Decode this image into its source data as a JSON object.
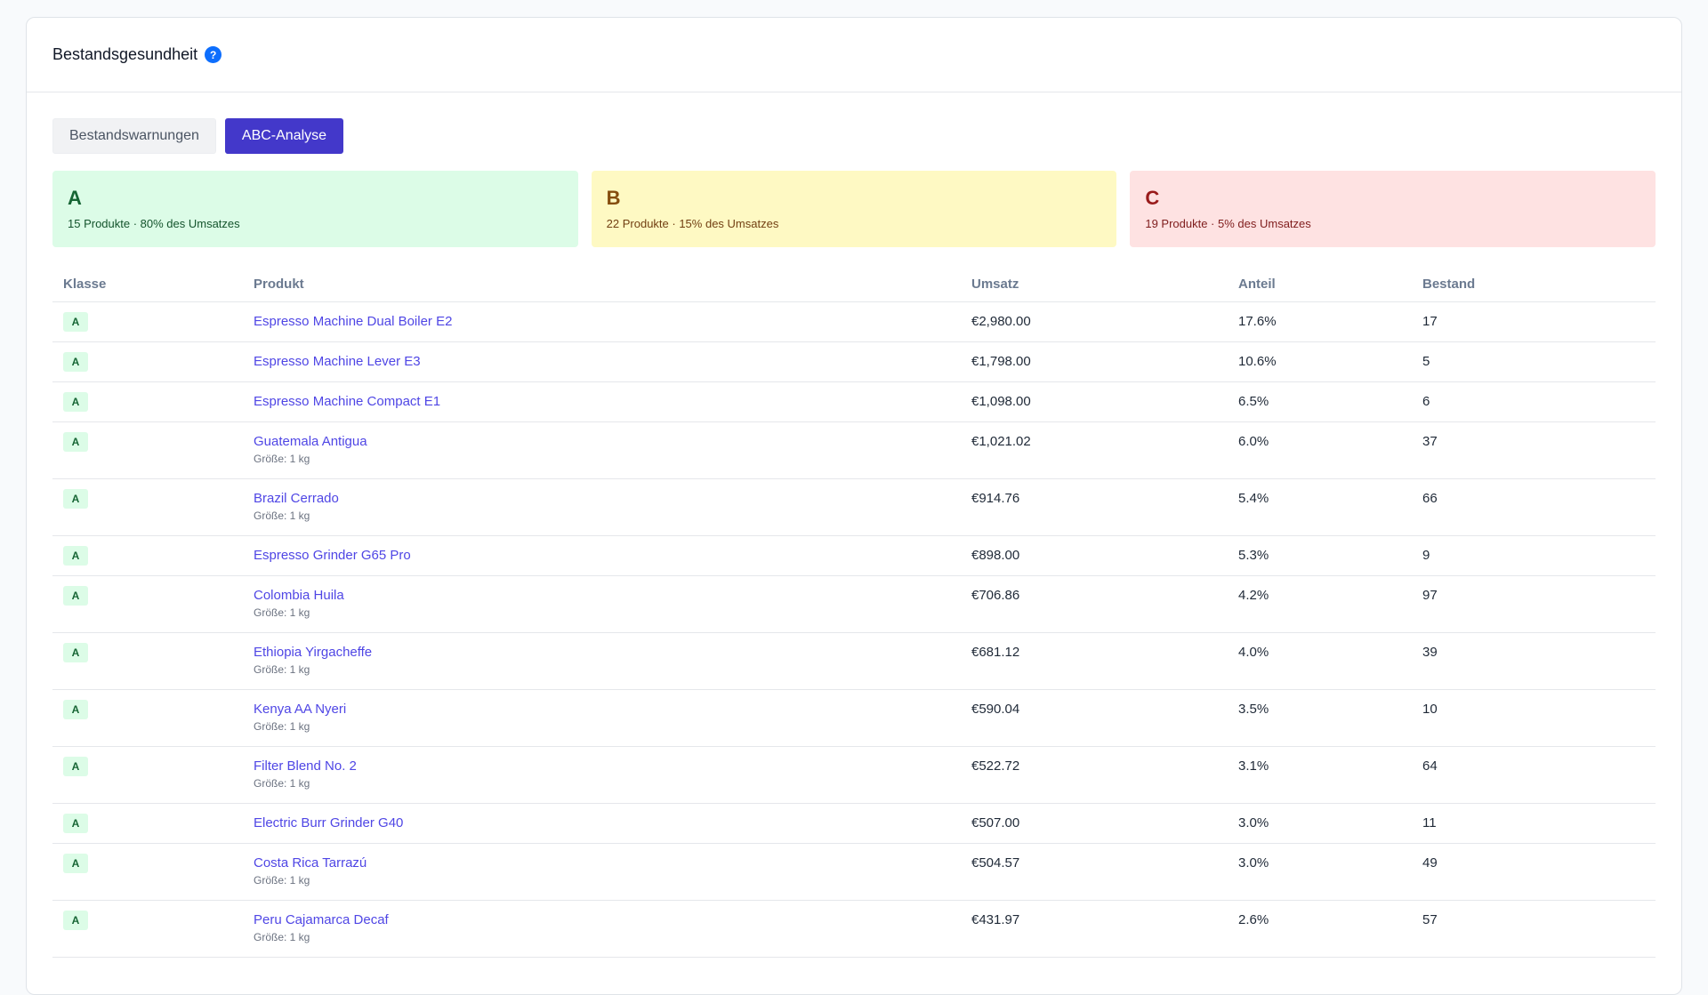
{
  "header": {
    "title": "Bestandsgesundheit",
    "help_icon": "?"
  },
  "tabs": [
    {
      "label": "Bestandswarnungen",
      "active": false
    },
    {
      "label": "ABC-Analyse",
      "active": true
    }
  ],
  "summary": [
    {
      "letter": "A",
      "text": "15 Produkte · 80% des Umsatzes",
      "color": "#dcfce7"
    },
    {
      "letter": "B",
      "text": "22 Produkte · 15% des Umsatzes",
      "color": "#fef9c3"
    },
    {
      "letter": "C",
      "text": "19 Produkte · 5% des Umsatzes",
      "color": "#fee2e2"
    }
  ],
  "table": {
    "columns": [
      "Klasse",
      "Produkt",
      "Umsatz",
      "Anteil",
      "Bestand"
    ],
    "rows": [
      {
        "klasse": "A",
        "produkt": "Espresso Machine Dual Boiler E2",
        "variant": "",
        "umsatz": "€2,980.00",
        "anteil": "17.6%",
        "bestand": "17"
      },
      {
        "klasse": "A",
        "produkt": "Espresso Machine Lever E3",
        "variant": "",
        "umsatz": "€1,798.00",
        "anteil": "10.6%",
        "bestand": "5"
      },
      {
        "klasse": "A",
        "produkt": "Espresso Machine Compact E1",
        "variant": "",
        "umsatz": "€1,098.00",
        "anteil": "6.5%",
        "bestand": "6"
      },
      {
        "klasse": "A",
        "produkt": "Guatemala Antigua",
        "variant": "Größe: 1 kg",
        "umsatz": "€1,021.02",
        "anteil": "6.0%",
        "bestand": "37"
      },
      {
        "klasse": "A",
        "produkt": "Brazil Cerrado",
        "variant": "Größe: 1 kg",
        "umsatz": "€914.76",
        "anteil": "5.4%",
        "bestand": "66"
      },
      {
        "klasse": "A",
        "produkt": "Espresso Grinder G65 Pro",
        "variant": "",
        "umsatz": "€898.00",
        "anteil": "5.3%",
        "bestand": "9"
      },
      {
        "klasse": "A",
        "produkt": "Colombia Huila",
        "variant": "Größe: 1 kg",
        "umsatz": "€706.86",
        "anteil": "4.2%",
        "bestand": "97"
      },
      {
        "klasse": "A",
        "produkt": "Ethiopia Yirgacheffe",
        "variant": "Größe: 1 kg",
        "umsatz": "€681.12",
        "anteil": "4.0%",
        "bestand": "39"
      },
      {
        "klasse": "A",
        "produkt": "Kenya AA Nyeri",
        "variant": "Größe: 1 kg",
        "umsatz": "€590.04",
        "anteil": "3.5%",
        "bestand": "10"
      },
      {
        "klasse": "A",
        "produkt": "Filter Blend No. 2",
        "variant": "Größe: 1 kg",
        "umsatz": "€522.72",
        "anteil": "3.1%",
        "bestand": "64"
      },
      {
        "klasse": "A",
        "produkt": "Electric Burr Grinder G40",
        "variant": "",
        "umsatz": "€507.00",
        "anteil": "3.0%",
        "bestand": "11"
      },
      {
        "klasse": "A",
        "produkt": "Costa Rica Tarrazú",
        "variant": "Größe: 1 kg",
        "umsatz": "€504.57",
        "anteil": "3.0%",
        "bestand": "49"
      },
      {
        "klasse": "A",
        "produkt": "Peru Cajamarca Decaf",
        "variant": "Größe: 1 kg",
        "umsatz": "€431.97",
        "anteil": "2.6%",
        "bestand": "57"
      }
    ]
  }
}
